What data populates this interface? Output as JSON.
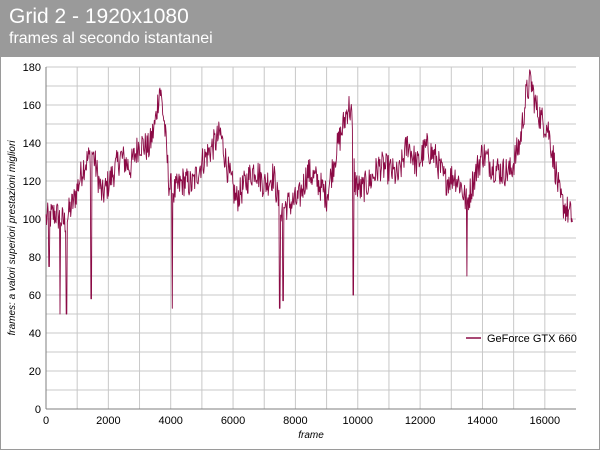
{
  "header": {
    "title": "Grid 2 - 1920x1080",
    "subtitle": "frames al secondo istantanei"
  },
  "chart_data": {
    "type": "line",
    "title": "Grid 2 - 1920x1080",
    "subtitle": "frames al secondo istantanei",
    "xlabel": "frame",
    "ylabel": "frames: a valori superiori prestazioni migliori",
    "xlim": [
      0,
      17000
    ],
    "ylim": [
      0,
      180
    ],
    "x_ticks": [
      0,
      2000,
      4000,
      6000,
      8000,
      10000,
      12000,
      14000,
      16000
    ],
    "y_ticks": [
      0,
      20,
      40,
      60,
      80,
      100,
      120,
      140,
      160,
      180
    ],
    "grid": true,
    "legend_position": "right",
    "series": [
      {
        "name": "GeForce GTX 660",
        "color": "#8b0a45",
        "x": [
          0,
          300,
          600,
          900,
          1200,
          1500,
          1800,
          2100,
          2400,
          2700,
          3000,
          3300,
          3500,
          3650,
          3800,
          3950,
          4100,
          4400,
          4700,
          5000,
          5300,
          5600,
          5800,
          6100,
          6400,
          6700,
          7000,
          7300,
          7500,
          7800,
          8100,
          8400,
          8700,
          9000,
          9300,
          9500,
          9700,
          9800,
          9900,
          10100,
          10400,
          10700,
          11000,
          11300,
          11600,
          11900,
          12200,
          12500,
          12800,
          13100,
          13300,
          13500,
          13700,
          14000,
          14300,
          14600,
          14900,
          15200,
          15400,
          15550,
          15700,
          15900,
          16100,
          16300,
          16500,
          16700,
          16900
        ],
        "values": [
          100,
          103,
          98,
          110,
          128,
          135,
          112,
          122,
          133,
          127,
          140,
          137,
          150,
          170,
          150,
          118,
          114,
          120,
          118,
          130,
          137,
          145,
          128,
          110,
          119,
          127,
          118,
          123,
          105,
          108,
          110,
          125,
          120,
          112,
          135,
          147,
          160,
          155,
          120,
          115,
          120,
          128,
          126,
          122,
          140,
          128,
          138,
          132,
          120,
          123,
          118,
          108,
          120,
          135,
          128,
          125,
          125,
          140,
          165,
          173,
          160,
          152,
          148,
          130,
          110,
          105,
          100
        ],
        "dips": [
          {
            "x": 100,
            "value": 75
          },
          {
            "x": 450,
            "value": 50
          },
          {
            "x": 650,
            "value": 50
          },
          {
            "x": 1450,
            "value": 58
          },
          {
            "x": 4050,
            "value": 53
          },
          {
            "x": 7500,
            "value": 53
          },
          {
            "x": 7600,
            "value": 57
          },
          {
            "x": 9850,
            "value": 60
          },
          {
            "x": 13500,
            "value": 70
          }
        ]
      }
    ]
  }
}
